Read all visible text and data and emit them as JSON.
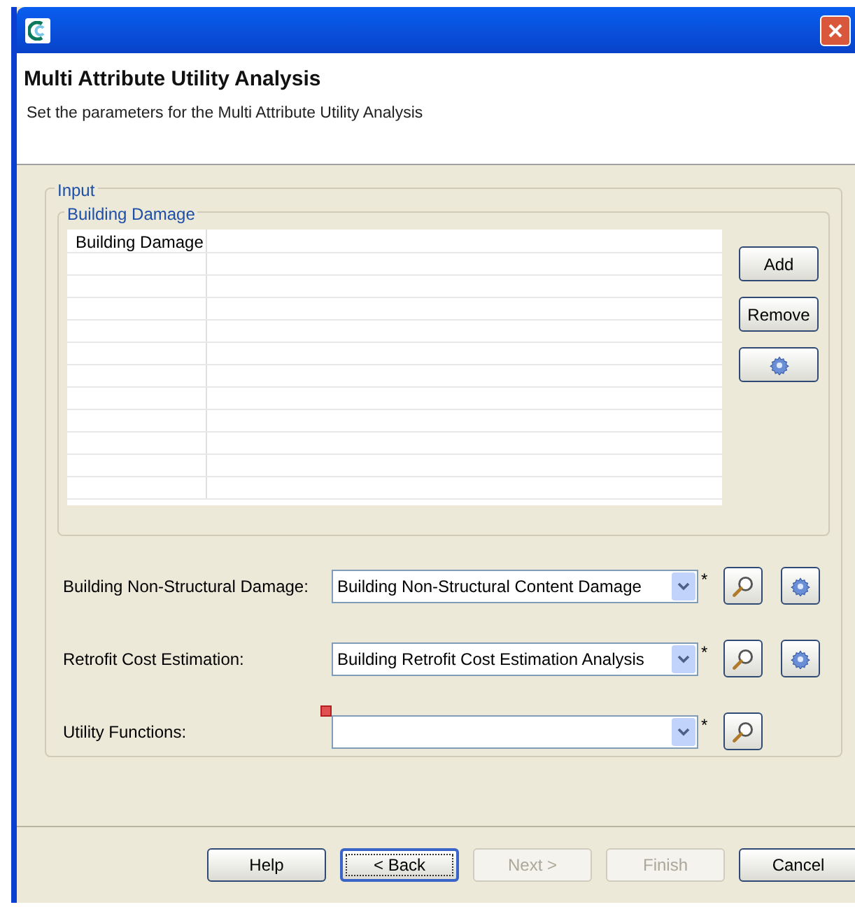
{
  "window": {
    "title": "Multi Attribute Utility Analysis",
    "subtitle": "Set the parameters for the Multi Attribute Utility Analysis"
  },
  "input_group": {
    "label": "Input",
    "building_damage": {
      "label": "Building Damage",
      "table": {
        "columns": [
          "Building Damage"
        ]
      },
      "buttons": [
        {
          "kind": "text",
          "label": "Add"
        },
        {
          "kind": "text",
          "label": "Remove"
        },
        {
          "kind": "gear"
        }
      ]
    },
    "fields": [
      {
        "label": "Building Non-Structural Damage:",
        "value": "Building Non-Structural Content Damage",
        "required_mark": "*",
        "error": false,
        "search": true,
        "settings": true
      },
      {
        "label": "Retrofit Cost Estimation:",
        "value": "Building Retrofit Cost Estimation Analysis",
        "required_mark": "*",
        "error": false,
        "search": true,
        "settings": true
      },
      {
        "label": "Utility Functions:",
        "required_mark": "*",
        "error": true,
        "search": true,
        "settings": false
      }
    ]
  },
  "buttons": [
    {
      "label": "Help",
      "selected": false,
      "disabled": false
    },
    {
      "label": "< Back",
      "selected": true,
      "disabled": false
    },
    {
      "label": "Next >",
      "selected": false,
      "disabled": true
    },
    {
      "label": "Finish",
      "selected": false,
      "disabled": true
    },
    {
      "label": "Cancel",
      "selected": false,
      "disabled": false
    }
  ]
}
